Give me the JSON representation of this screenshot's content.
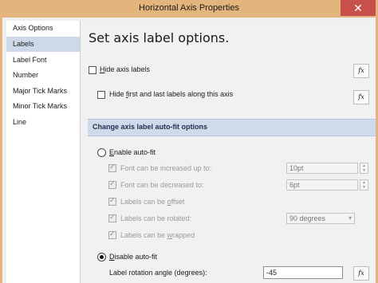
{
  "window": {
    "title": "Horizontal Axis Properties",
    "close_glyph": "✕"
  },
  "sidebar": {
    "items": [
      {
        "label": "Axis Options"
      },
      {
        "label": "Labels",
        "selected": true
      },
      {
        "label": "Label Font"
      },
      {
        "label": "Number"
      },
      {
        "label": "Major Tick Marks"
      },
      {
        "label": "Minor Tick Marks"
      },
      {
        "label": "Line"
      }
    ]
  },
  "main": {
    "heading": "Set axis label options.",
    "hide_axis_labels": {
      "pre": "",
      "key": "H",
      "post": "ide axis labels",
      "checked": false
    },
    "hide_first_last": {
      "pre": "Hide ",
      "key": "f",
      "post": "irst and last labels along this axis",
      "checked": false
    },
    "fx_label": "fx",
    "section_title": "Change axis label auto-fit options",
    "enable_autofit": {
      "pre": "",
      "key": "E",
      "post": "nable auto-fit",
      "selected": false
    },
    "autofit_options": [
      {
        "label": "Font can be increased up to:",
        "checked": true,
        "value": "10pt"
      },
      {
        "label": "Font can be decreased to:",
        "checked": true,
        "value": "6pt"
      },
      {
        "pre": "Labels can be ",
        "key": "o",
        "post": "ffset",
        "checked": true
      },
      {
        "label": "Labels can be rotated:",
        "checked": true,
        "value": "90 degrees"
      },
      {
        "pre": "Labels can be ",
        "key": "w",
        "post": "rapped",
        "checked": true
      }
    ],
    "disable_autofit": {
      "pre": "",
      "key": "D",
      "post": "isable auto-fit",
      "selected": true
    },
    "rotation_angle": {
      "label": "Label rotation angle (degrees):",
      "value": "-45"
    }
  },
  "colors": {
    "titlebar": "#e3b57d",
    "close_button": "#c7504a",
    "section_bar": "#cddbea",
    "selected_nav": "#cdd9e8"
  },
  "icons": {
    "close": "close-icon",
    "fx": "function-icon",
    "spin": "spinner-arrows-icon",
    "dropdown": "chevron-down-icon"
  }
}
